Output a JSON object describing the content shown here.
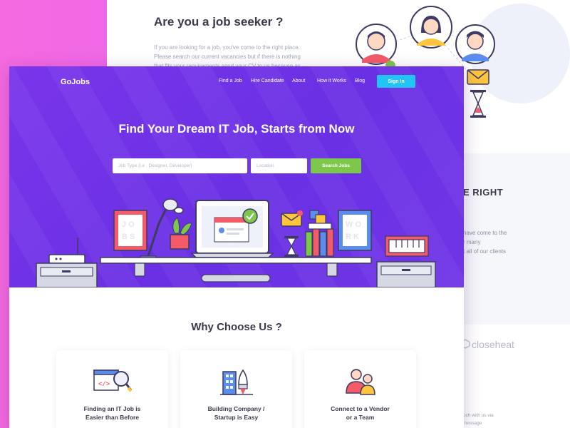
{
  "back_page": {
    "title": "Are you a job seeker ?",
    "paragraph": "If you are looking for a job, you've come to the right place. Please search our current vacancies but if there is nothing that fits your requirements send your CV to us because as part of",
    "heading2_partial": "E RIGHT",
    "lines_partial": [
      "have come to the",
      "r many",
      "t all of our clients"
    ],
    "partner_logo": "closeheat",
    "small_lines_partial": [
      "uch with us via",
      "message"
    ]
  },
  "front_page": {
    "logo": "GoJobs",
    "nav": {
      "items": [
        "Find a Job",
        "Hire Candidate",
        "About",
        "How it Works",
        "Blog"
      ],
      "signin_label": "Sign In"
    },
    "hero": {
      "title": "Find Your Dream IT Job, Starts from Now",
      "job_type_placeholder": "Job Type (i.e : Designer, Developer)",
      "location_placeholder": "Location",
      "search_button": "Search Jobs"
    },
    "why_section": {
      "title": "Why Choose Us ?",
      "features": [
        {
          "icon": "code-search-icon",
          "label": "Finding an IT Job is\nEasier than Before"
        },
        {
          "icon": "company-building-icon",
          "label": "Building Company /\nStartup is Easy"
        },
        {
          "icon": "people-team-icon",
          "label": "Connect to a Vendor\nor a Team"
        }
      ]
    }
  },
  "colors": {
    "background_pink": "#f56ae0",
    "hero_purple": "#7a35ea",
    "signin_blue": "#21c4f3",
    "search_green": "#7dc84a",
    "text_dark": "#3a3a4a"
  }
}
